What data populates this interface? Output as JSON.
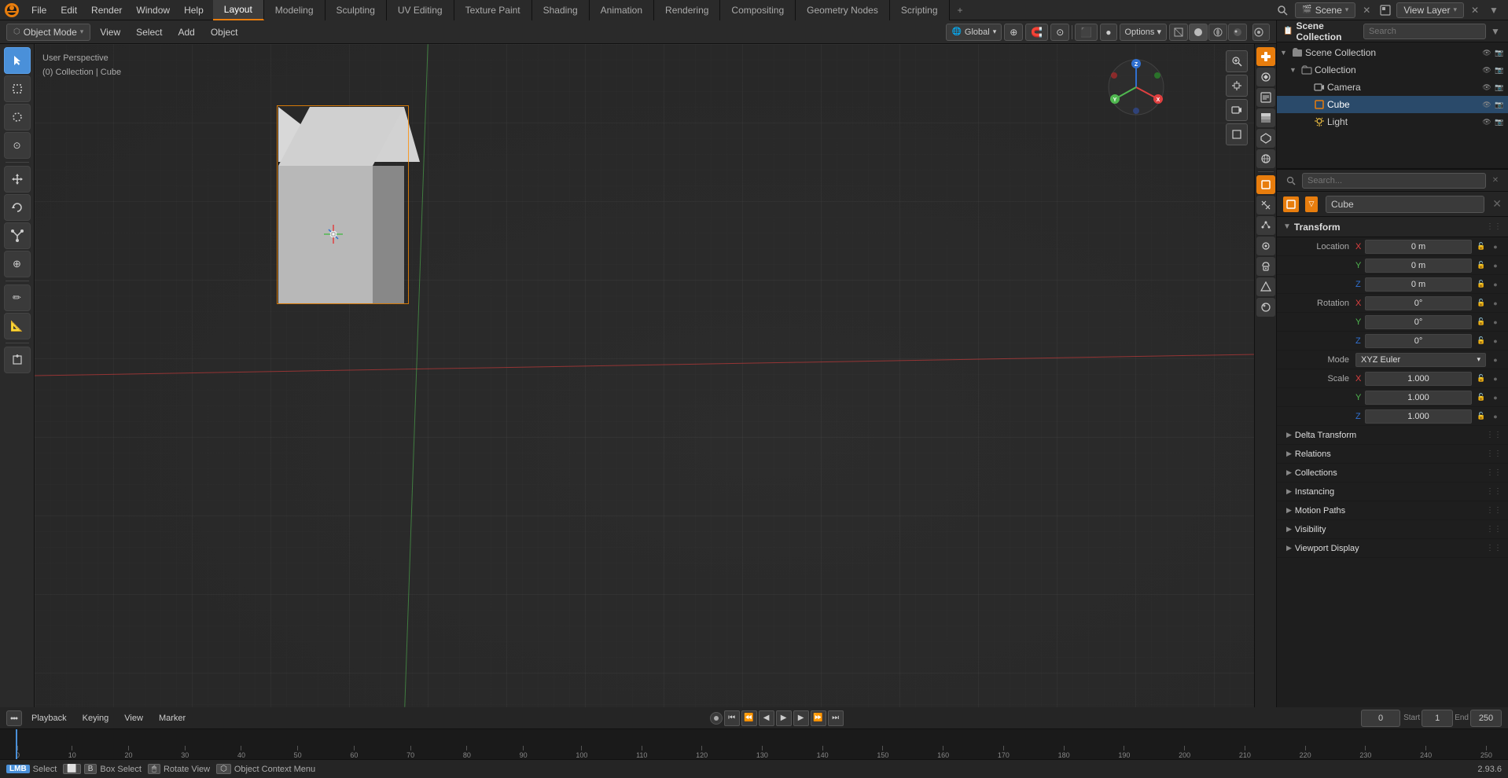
{
  "app": {
    "name": "Blender",
    "version": "2.93.6"
  },
  "topbar": {
    "menu_items": [
      "File",
      "Edit",
      "Render",
      "Window",
      "Help"
    ],
    "active_workspace": "Layout",
    "workspaces": [
      "Layout",
      "Modeling",
      "Sculpting",
      "UV Editing",
      "Texture Paint",
      "Shading",
      "Animation",
      "Rendering",
      "Compositing",
      "Geometry Nodes",
      "Scripting"
    ],
    "add_tab_label": "+",
    "scene_label": "Scene",
    "view_layer_label": "View Layer",
    "search_placeholder": "Search"
  },
  "viewport_header": {
    "mode_label": "Object Mode",
    "mode_arrow": "▾",
    "view_label": "View",
    "select_label": "Select",
    "add_label": "Add",
    "object_label": "Object",
    "options_label": "Options ▾",
    "global_label": "Global",
    "global_arrow": "▾"
  },
  "viewport": {
    "info_line1": "User Perspective",
    "info_line2": "(0) Collection | Cube"
  },
  "outliner": {
    "header_title": "Scene Collection",
    "search_placeholder": "Search",
    "items": [
      {
        "name": "Collection",
        "type": "collection",
        "icon": "📁",
        "indent": 0
      },
      {
        "name": "Camera",
        "type": "camera",
        "icon": "📷",
        "indent": 1
      },
      {
        "name": "Cube",
        "type": "mesh",
        "icon": "⬜",
        "indent": 1,
        "selected": true
      },
      {
        "name": "Light",
        "type": "light",
        "icon": "💡",
        "indent": 1
      }
    ]
  },
  "properties": {
    "object_name": "Cube",
    "pin_label": "✕",
    "transform_label": "Transform",
    "location": {
      "label": "Location",
      "x_label": "X",
      "y_label": "Y",
      "z_label": "Z",
      "x_value": "0 m",
      "y_value": "0 m",
      "z_value": "0 m"
    },
    "rotation": {
      "label": "Rotation",
      "x_label": "X",
      "y_label": "Y",
      "z_label": "Z",
      "x_value": "0°",
      "y_value": "0°",
      "z_value": "0°",
      "mode_label": "Mode",
      "mode_value": "XYZ Euler",
      "mode_arrow": "▾"
    },
    "scale": {
      "label": "Scale",
      "x_label": "X",
      "y_label": "Y",
      "z_label": "Z",
      "x_value": "1.000",
      "y_value": "1.000",
      "z_value": "1.000"
    },
    "sections": [
      {
        "name": "delta_transform",
        "label": "Delta Transform",
        "collapsed": true
      },
      {
        "name": "relations",
        "label": "Relations",
        "collapsed": true
      },
      {
        "name": "collections",
        "label": "Collections",
        "collapsed": true
      },
      {
        "name": "instancing",
        "label": "Instancing",
        "collapsed": true
      },
      {
        "name": "motion_paths",
        "label": "Motion Paths",
        "collapsed": true
      },
      {
        "name": "visibility",
        "label": "Visibility",
        "collapsed": true
      },
      {
        "name": "viewport_display",
        "label": "Viewport Display",
        "collapsed": true
      }
    ]
  },
  "timeline": {
    "playback_label": "Playback",
    "keying_label": "Keying",
    "view_label": "View",
    "marker_label": "Marker",
    "start_label": "Start",
    "start_value": "1",
    "end_label": "End",
    "end_value": "250",
    "current_frame": "0",
    "frame_ticks": [
      0,
      10,
      20,
      30,
      40,
      50,
      60,
      70,
      80,
      90,
      100,
      110,
      120,
      130,
      140,
      150,
      160,
      170,
      180,
      190,
      200,
      210,
      220,
      230,
      240,
      250
    ]
  },
  "statusbar": {
    "select_label": "Select",
    "select_key": "LMB",
    "box_select_label": "Box Select",
    "box_select_key": "B",
    "rotate_view_label": "Rotate View",
    "rotate_view_key": "MMB",
    "context_menu_label": "Object Context Menu",
    "context_menu_key": "RMB",
    "version": "2.93.6"
  },
  "icons": {
    "arrow_cursor": "↖",
    "box_select": "⬜",
    "lasso": "⊙",
    "move": "✥",
    "rotate": "↻",
    "scale": "⤡",
    "transform": "⊕",
    "annotate": "✏",
    "measure": "📐",
    "add_cube": "⬛",
    "search": "🔍",
    "hand": "✋",
    "camera": "🎥",
    "grid": "⊞",
    "gizmo_x": "X",
    "gizmo_y": "Y",
    "gizmo_z": "Z",
    "close": "✕",
    "menu": "≡",
    "chevron_right": "▶",
    "chevron_down": "▼",
    "dots": "⋮"
  },
  "colors": {
    "accent_orange": "#e87d0d",
    "accent_blue": "#4a90d9",
    "axis_x_color": "#e03030",
    "axis_y_color": "#50b850",
    "axis_z_color": "#3070d0",
    "bg_dark": "#1a1a1a",
    "bg_mid": "#252525",
    "bg_light": "#3a3a3a",
    "text_main": "#cccccc",
    "selected_blue": "#2a4a6a"
  }
}
